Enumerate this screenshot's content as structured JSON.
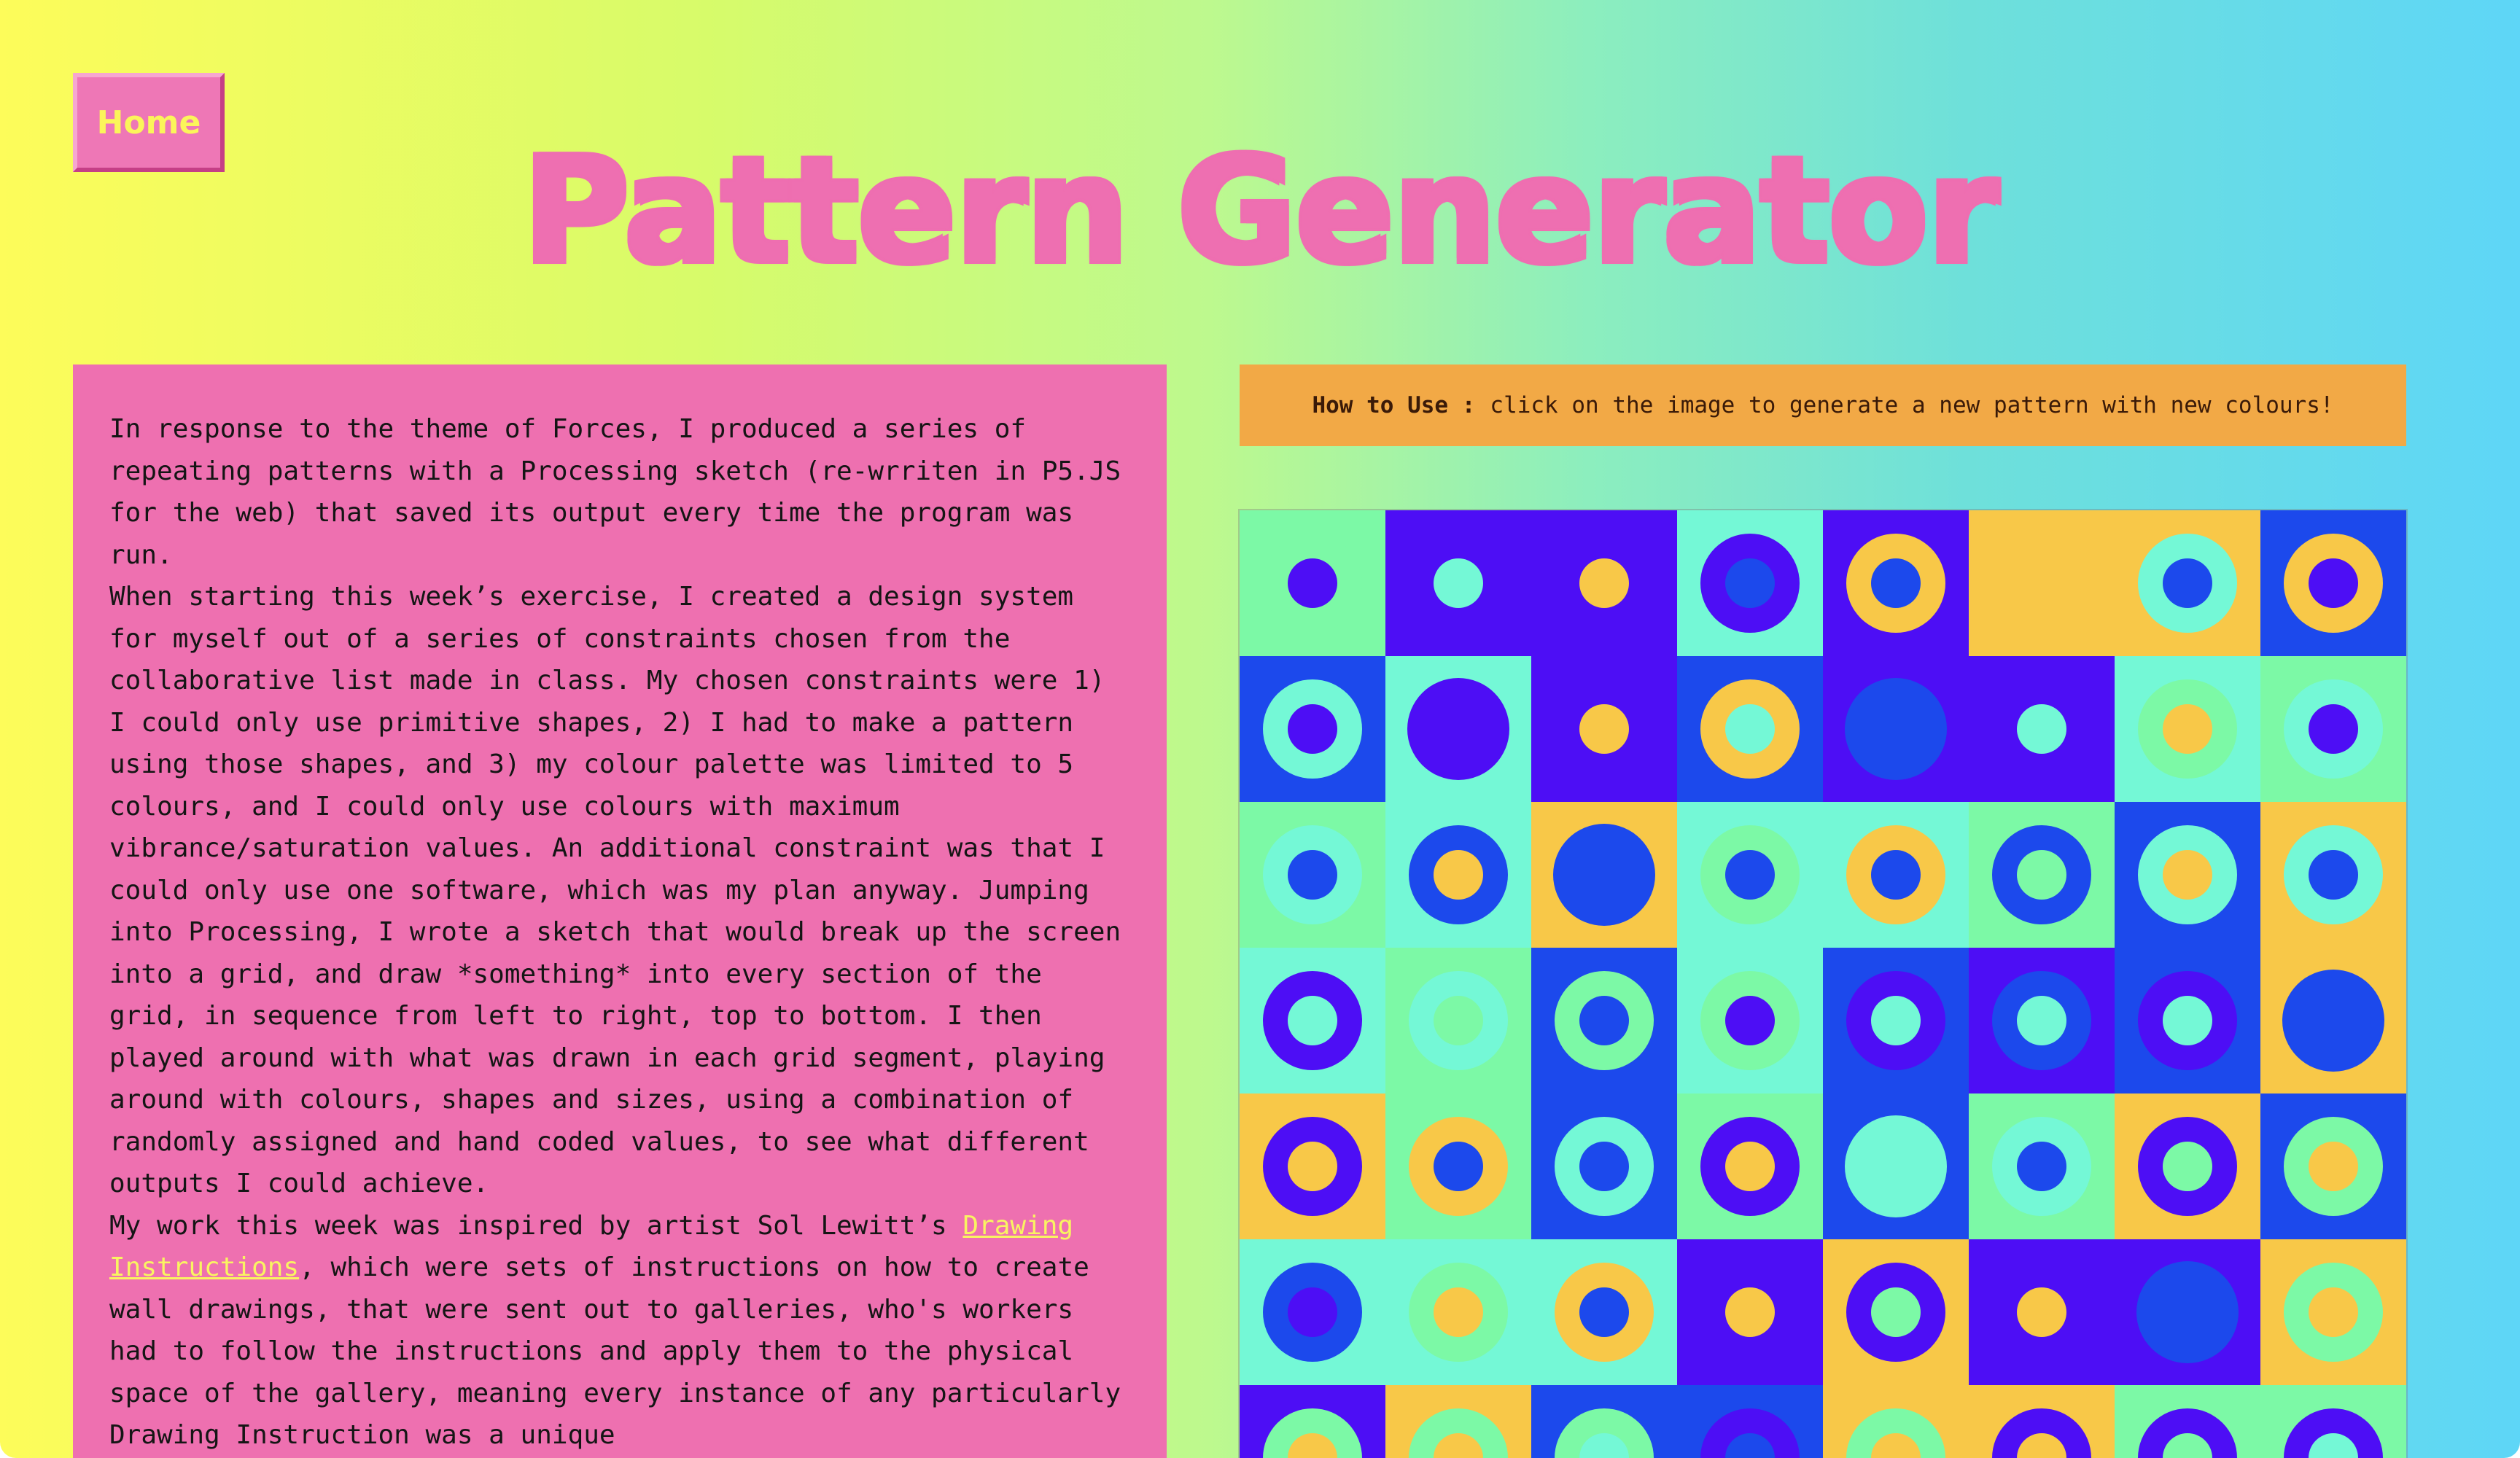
{
  "nav": {
    "home_label": "Home"
  },
  "header": {
    "title": "Pattern Generator"
  },
  "article": {
    "paragraph1": "In response to the theme of Forces, I produced a series of repeating patterns with a Processing sketch (re-wrriten in P5.JS for the web) that saved its output every time the program was run.",
    "paragraph2": "When starting this week’s exercise, I created a design system for myself out of a series of constraints chosen from the collaborative list made in class. My chosen constraints were 1) I could only use primitive shapes, 2) I had to make a pattern using those shapes, and 3) my colour palette was limited to 5 colours, and I could only use colours with maximum vibrance/saturation values. An additional constraint was that I could only use one software, which was my plan anyway. Jumping into Processing, I wrote a sketch that would break up the screen into a grid, and draw *something* into every section of the grid, in sequence from left to right, top to bottom. I then played around with what was drawn in each grid segment, playing around with colours, shapes and sizes, using a combination of randomly assigned and hand coded values, to see what different outputs I could achieve.",
    "paragraph3_before_link": "My work this week was inspired by artist Sol Lewitt’s ",
    "link_text": "Drawing Instructions",
    "paragraph3_after_link": ", which were sets of instructions on how to create wall drawings, that were sent out to galleries, who's workers had to follow the instructions and apply them to the physical space of the gallery, meaning every instance of any particularly Drawing Instruction was a unique"
  },
  "howto": {
    "label": "How to Use :",
    "text": "click on the image to generate a new pattern with new colours!"
  },
  "colors": {
    "mint": "#7cf9a6",
    "aqua": "#74f8d6",
    "violet": "#4d0ef5",
    "blue": "#1c49ec",
    "yellow": "#f8c848",
    "pink": "#ee70b0",
    "orange": "#f2a946"
  },
  "pattern": {
    "columns": 8,
    "visible_rows": 7,
    "cells": [
      [
        "mint",
        "mint",
        "violet",
        null
      ],
      [
        "violet",
        "aqua",
        null,
        null
      ],
      [
        "violet",
        "yellow",
        null,
        null
      ],
      [
        "aqua",
        "violet",
        "blue",
        null
      ],
      [
        "violet",
        "yellow",
        "blue",
        null
      ],
      [
        "yellow",
        null,
        null,
        null
      ],
      [
        "yellow",
        "aqua",
        "blue",
        null
      ],
      [
        "blue",
        "yellow",
        "violet",
        null
      ],
      [
        "blue",
        "aqua",
        "violet",
        null
      ],
      [
        "aqua",
        "violet",
        null,
        null
      ],
      [
        "violet",
        "yellow",
        null,
        null
      ],
      [
        "blue",
        "yellow",
        "aqua",
        null
      ],
      [
        "violet",
        "blue",
        null,
        null
      ],
      [
        "violet",
        "aqua",
        null,
        null
      ],
      [
        "aqua",
        "mint",
        "yellow",
        null
      ],
      [
        "mint",
        "aqua",
        "violet",
        null
      ],
      [
        "mint",
        "aqua",
        "blue",
        null
      ],
      [
        "aqua",
        "blue",
        "yellow",
        null
      ],
      [
        "yellow",
        "blue",
        null,
        null
      ],
      [
        "aqua",
        "mint",
        "blue",
        null
      ],
      [
        "aqua",
        "yellow",
        "blue",
        null
      ],
      [
        "mint",
        "blue",
        "mint",
        null
      ],
      [
        "blue",
        "aqua",
        "yellow",
        null
      ],
      [
        "yellow",
        "aqua",
        "blue",
        null
      ],
      [
        "aqua",
        "violet",
        "aqua",
        null
      ],
      [
        "mint",
        "aqua",
        "mint",
        null
      ],
      [
        "blue",
        "mint",
        "blue",
        null
      ],
      [
        "aqua",
        "mint",
        "violet",
        null
      ],
      [
        "blue",
        "violet",
        "aqua",
        null
      ],
      [
        "violet",
        "blue",
        "aqua",
        null
      ],
      [
        "blue",
        "violet",
        "aqua",
        null
      ],
      [
        "yellow",
        "blue",
        null,
        null
      ],
      [
        "yellow",
        "violet",
        "yellow",
        null
      ],
      [
        "mint",
        "yellow",
        "blue",
        null
      ],
      [
        "blue",
        "aqua",
        "blue",
        null
      ],
      [
        "mint",
        "violet",
        "yellow",
        null
      ],
      [
        "blue",
        "aqua",
        null,
        null
      ],
      [
        "mint",
        "aqua",
        "blue",
        null
      ],
      [
        "yellow",
        "violet",
        "mint",
        null
      ],
      [
        "blue",
        "mint",
        "yellow",
        null
      ],
      [
        "aqua",
        "blue",
        "violet",
        null
      ],
      [
        "aqua",
        "mint",
        "yellow",
        null
      ],
      [
        "aqua",
        "yellow",
        "blue",
        null
      ],
      [
        "violet",
        "yellow",
        null,
        null
      ],
      [
        "yellow",
        "violet",
        "mint",
        null
      ],
      [
        "violet",
        "yellow",
        null,
        null
      ],
      [
        "violet",
        "blue",
        null,
        null
      ],
      [
        "yellow",
        "mint",
        "yellow",
        null
      ],
      [
        "violet",
        "mint",
        "yellow",
        null
      ],
      [
        "yellow",
        "mint",
        "yellow",
        null
      ],
      [
        "blue",
        "mint",
        "aqua",
        null
      ],
      [
        "blue",
        "violet",
        "blue",
        null
      ],
      [
        "yellow",
        "mint",
        "yellow",
        null
      ],
      [
        "yellow",
        "violet",
        "yellow",
        null
      ],
      [
        "mint",
        "violet",
        "mint",
        null
      ],
      [
        "mint",
        "violet",
        "aqua",
        null
      ]
    ]
  }
}
